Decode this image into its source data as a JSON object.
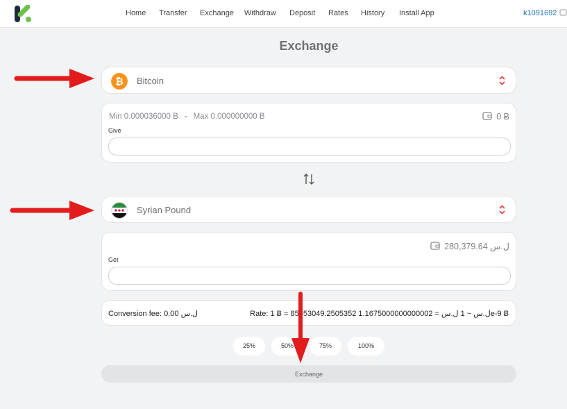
{
  "nav": {
    "items": [
      "Home",
      "Transfer",
      "Exchange",
      "Withdraw",
      "Deposit",
      "Rates",
      "History",
      "Install App"
    ],
    "user": "k1091692"
  },
  "page": {
    "title": "Exchange"
  },
  "give": {
    "currency": "Bitcoin",
    "icon": "bitcoin-icon",
    "min": "Min 0.000036000 Ƀ",
    "separator": "-",
    "max": "Max 0.000000000 Ƀ",
    "balance": "0 Ƀ",
    "label": "Give",
    "value": ""
  },
  "get": {
    "currency": "Syrian Pound",
    "icon": "syria-flag-icon",
    "balance": "280,379.64 ل.س",
    "label": "Get",
    "value": ""
  },
  "conversion": {
    "fee": "Conversion fee: 0.00 ل.س",
    "rate": "Rate: 1 Ƀ = 85653049.2505352 ل.س ~ 1 ل.س = 1.1675000000000002e-9 Ƀ"
  },
  "percentages": [
    "25%",
    "50%",
    "75%",
    "100%"
  ],
  "exchange_button": "Exchange",
  "colors": {
    "accent_green": "#6cc24a",
    "brand_dark": "#1e2a3a",
    "bitcoin_orange": "#f7931a",
    "caret_red": "#e03a3a",
    "annotation_arrow": "#e21c1c"
  }
}
